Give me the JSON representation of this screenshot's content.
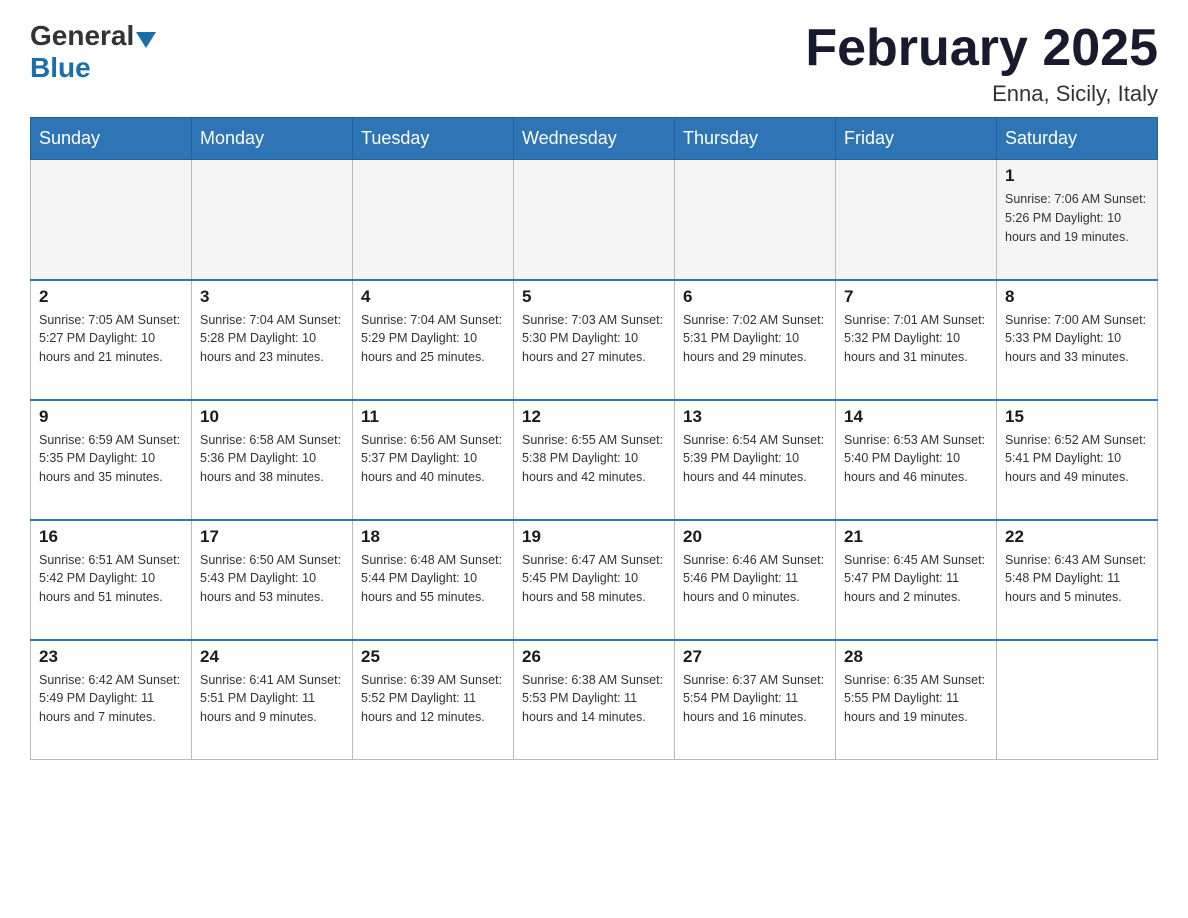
{
  "logo": {
    "general": "General",
    "blue": "Blue"
  },
  "title": "February 2025",
  "location": "Enna, Sicily, Italy",
  "days_of_week": [
    "Sunday",
    "Monday",
    "Tuesday",
    "Wednesday",
    "Thursday",
    "Friday",
    "Saturday"
  ],
  "weeks": [
    [
      {
        "day": "",
        "info": ""
      },
      {
        "day": "",
        "info": ""
      },
      {
        "day": "",
        "info": ""
      },
      {
        "day": "",
        "info": ""
      },
      {
        "day": "",
        "info": ""
      },
      {
        "day": "",
        "info": ""
      },
      {
        "day": "1",
        "info": "Sunrise: 7:06 AM\nSunset: 5:26 PM\nDaylight: 10 hours\nand 19 minutes."
      }
    ],
    [
      {
        "day": "2",
        "info": "Sunrise: 7:05 AM\nSunset: 5:27 PM\nDaylight: 10 hours\nand 21 minutes."
      },
      {
        "day": "3",
        "info": "Sunrise: 7:04 AM\nSunset: 5:28 PM\nDaylight: 10 hours\nand 23 minutes."
      },
      {
        "day": "4",
        "info": "Sunrise: 7:04 AM\nSunset: 5:29 PM\nDaylight: 10 hours\nand 25 minutes."
      },
      {
        "day": "5",
        "info": "Sunrise: 7:03 AM\nSunset: 5:30 PM\nDaylight: 10 hours\nand 27 minutes."
      },
      {
        "day": "6",
        "info": "Sunrise: 7:02 AM\nSunset: 5:31 PM\nDaylight: 10 hours\nand 29 minutes."
      },
      {
        "day": "7",
        "info": "Sunrise: 7:01 AM\nSunset: 5:32 PM\nDaylight: 10 hours\nand 31 minutes."
      },
      {
        "day": "8",
        "info": "Sunrise: 7:00 AM\nSunset: 5:33 PM\nDaylight: 10 hours\nand 33 minutes."
      }
    ],
    [
      {
        "day": "9",
        "info": "Sunrise: 6:59 AM\nSunset: 5:35 PM\nDaylight: 10 hours\nand 35 minutes."
      },
      {
        "day": "10",
        "info": "Sunrise: 6:58 AM\nSunset: 5:36 PM\nDaylight: 10 hours\nand 38 minutes."
      },
      {
        "day": "11",
        "info": "Sunrise: 6:56 AM\nSunset: 5:37 PM\nDaylight: 10 hours\nand 40 minutes."
      },
      {
        "day": "12",
        "info": "Sunrise: 6:55 AM\nSunset: 5:38 PM\nDaylight: 10 hours\nand 42 minutes."
      },
      {
        "day": "13",
        "info": "Sunrise: 6:54 AM\nSunset: 5:39 PM\nDaylight: 10 hours\nand 44 minutes."
      },
      {
        "day": "14",
        "info": "Sunrise: 6:53 AM\nSunset: 5:40 PM\nDaylight: 10 hours\nand 46 minutes."
      },
      {
        "day": "15",
        "info": "Sunrise: 6:52 AM\nSunset: 5:41 PM\nDaylight: 10 hours\nand 49 minutes."
      }
    ],
    [
      {
        "day": "16",
        "info": "Sunrise: 6:51 AM\nSunset: 5:42 PM\nDaylight: 10 hours\nand 51 minutes."
      },
      {
        "day": "17",
        "info": "Sunrise: 6:50 AM\nSunset: 5:43 PM\nDaylight: 10 hours\nand 53 minutes."
      },
      {
        "day": "18",
        "info": "Sunrise: 6:48 AM\nSunset: 5:44 PM\nDaylight: 10 hours\nand 55 minutes."
      },
      {
        "day": "19",
        "info": "Sunrise: 6:47 AM\nSunset: 5:45 PM\nDaylight: 10 hours\nand 58 minutes."
      },
      {
        "day": "20",
        "info": "Sunrise: 6:46 AM\nSunset: 5:46 PM\nDaylight: 11 hours\nand 0 minutes."
      },
      {
        "day": "21",
        "info": "Sunrise: 6:45 AM\nSunset: 5:47 PM\nDaylight: 11 hours\nand 2 minutes."
      },
      {
        "day": "22",
        "info": "Sunrise: 6:43 AM\nSunset: 5:48 PM\nDaylight: 11 hours\nand 5 minutes."
      }
    ],
    [
      {
        "day": "23",
        "info": "Sunrise: 6:42 AM\nSunset: 5:49 PM\nDaylight: 11 hours\nand 7 minutes."
      },
      {
        "day": "24",
        "info": "Sunrise: 6:41 AM\nSunset: 5:51 PM\nDaylight: 11 hours\nand 9 minutes."
      },
      {
        "day": "25",
        "info": "Sunrise: 6:39 AM\nSunset: 5:52 PM\nDaylight: 11 hours\nand 12 minutes."
      },
      {
        "day": "26",
        "info": "Sunrise: 6:38 AM\nSunset: 5:53 PM\nDaylight: 11 hours\nand 14 minutes."
      },
      {
        "day": "27",
        "info": "Sunrise: 6:37 AM\nSunset: 5:54 PM\nDaylight: 11 hours\nand 16 minutes."
      },
      {
        "day": "28",
        "info": "Sunrise: 6:35 AM\nSunset: 5:55 PM\nDaylight: 11 hours\nand 19 minutes."
      },
      {
        "day": "",
        "info": ""
      }
    ]
  ]
}
